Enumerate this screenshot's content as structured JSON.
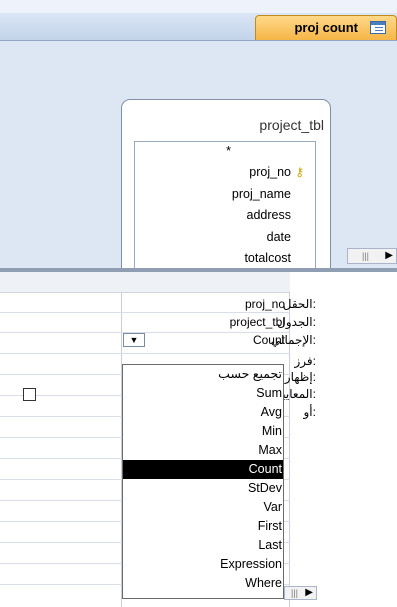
{
  "tab": {
    "label": "proj count",
    "icon": "query-icon"
  },
  "table": {
    "title": "project_tbl",
    "fields": [
      "*",
      "proj_no",
      "proj_name",
      "address",
      "date",
      "totalcost"
    ]
  },
  "grid": {
    "labels": [
      "الحقل:",
      "الجدول:",
      "الإجمالي:",
      "فرز:",
      "إظهار:",
      "المعايير:",
      "أو:"
    ],
    "field_value": "proj_no",
    "table_value": "project_tbl",
    "total_value": "Count"
  },
  "dropdown": {
    "options": [
      "تجميع حسب",
      "Sum",
      "Avg",
      "Min",
      "Max",
      "Count",
      "StDev",
      "Var",
      "First",
      "Last",
      "Expression",
      "Where"
    ],
    "selected": "Count"
  },
  "icons": {
    "key": "primary-key-icon",
    "dropdown": "chevron-down-icon",
    "scroll_h": "scroll-right-icon"
  }
}
